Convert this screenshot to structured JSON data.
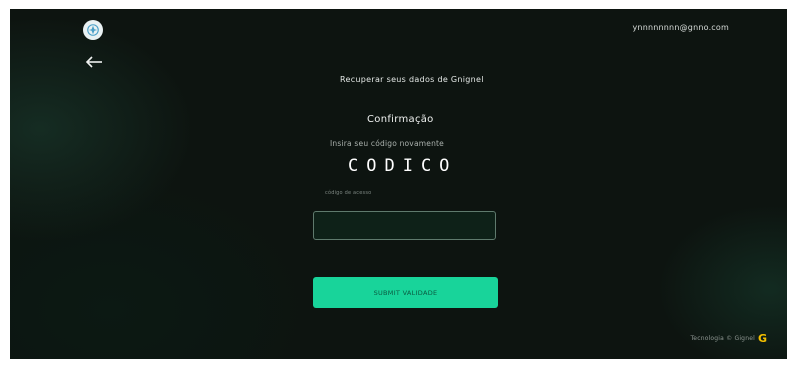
{
  "header": {
    "user_email": "ynnnnnnnn@gnno.com"
  },
  "main": {
    "heading": "Recuperar seus dados de Gnignel",
    "title": "Confirmação",
    "subtitle": "Insira seu código novamente",
    "code": "CODICO",
    "field_label": "código de acesso",
    "input_value": "",
    "input_placeholder": "",
    "submit_label": "SUBMIT VALIDADE"
  },
  "footer": {
    "text": "Tecnologia © Gignel",
    "brand_letter": "G"
  },
  "colors": {
    "background": "#0d1410",
    "accent": "#18d49a",
    "brand": "#f5c000"
  },
  "icons": {
    "logo": "logo-icon",
    "back": "back-arrow-icon"
  }
}
